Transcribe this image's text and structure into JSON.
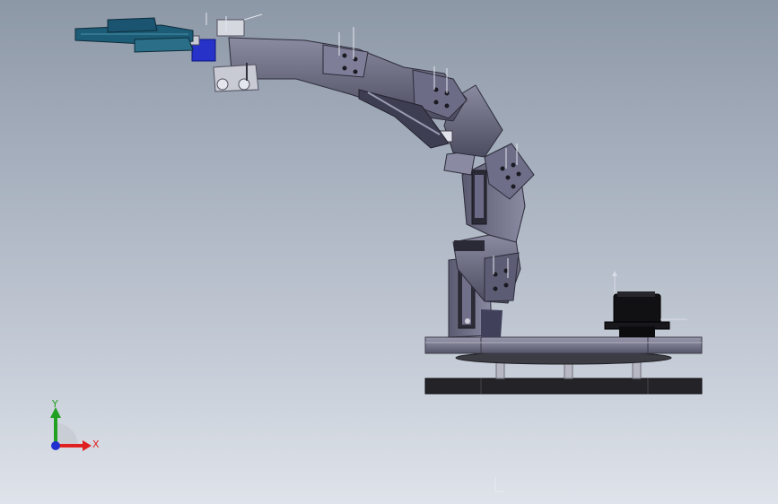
{
  "viewport": {
    "background_top": "#8d98a7",
    "background_bottom": "#dfe3ea"
  },
  "triad": {
    "x_label": "X",
    "y_label": "Y",
    "x_color": "#e02020",
    "y_color": "#22a022",
    "z_color": "#2030d0"
  },
  "model": {
    "part_color": "#5f5f78",
    "part_dark": "#3a3a4c",
    "gripper_color": "#1f5f78",
    "servo_color": "#111111",
    "base_plate_color": "#6a6a7e",
    "base_lower_color": "#222228",
    "standoff_color": "#b0b0bc"
  }
}
